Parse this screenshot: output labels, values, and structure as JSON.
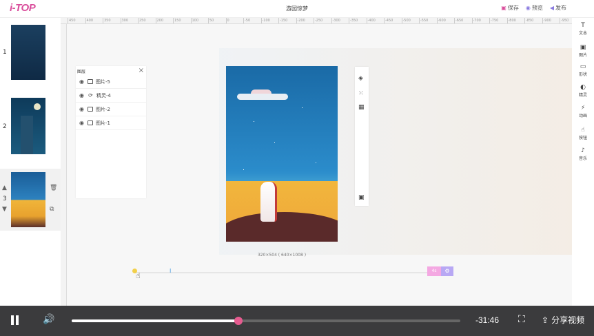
{
  "app": {
    "logo": "i-TOP",
    "doc_title": "游园惊梦"
  },
  "top_actions": [
    {
      "name": "save",
      "label": "保存",
      "icon": "save-icon"
    },
    {
      "name": "preview",
      "label": "预览",
      "icon": "eye-icon"
    },
    {
      "name": "publish",
      "label": "发布",
      "icon": "send-icon"
    }
  ],
  "pages": [
    "1",
    "2",
    "3"
  ],
  "ruler": {
    "ticks": [
      "450",
      "400",
      "350",
      "300",
      "250",
      "200",
      "150",
      "100",
      "50",
      "0",
      "-50",
      "-100",
      "-150",
      "-200",
      "-250",
      "-300",
      "-350",
      "-400",
      "-450",
      "-500",
      "-550",
      "-600",
      "-650",
      "-700",
      "-750",
      "-800",
      "-850",
      "-900",
      "-950"
    ]
  },
  "layers": {
    "title": "图层",
    "items": [
      "图片-5",
      "精灵-4",
      "图片-2",
      "图片-1"
    ]
  },
  "canvas": {
    "dimensions": "320×504 ( 640×1008 )"
  },
  "timeline": {
    "badge": "4s"
  },
  "right_tools": [
    "文本",
    "图片",
    "形状",
    "精灵",
    "动画",
    "按钮",
    "音乐"
  ],
  "video": {
    "progress": 0.429,
    "time": "-31:46",
    "share": "分享视频"
  },
  "colors": {
    "accent_pink": "#e65b8f",
    "accent_purple": "#8a7be0",
    "video_bar": "#3b3b3d"
  }
}
